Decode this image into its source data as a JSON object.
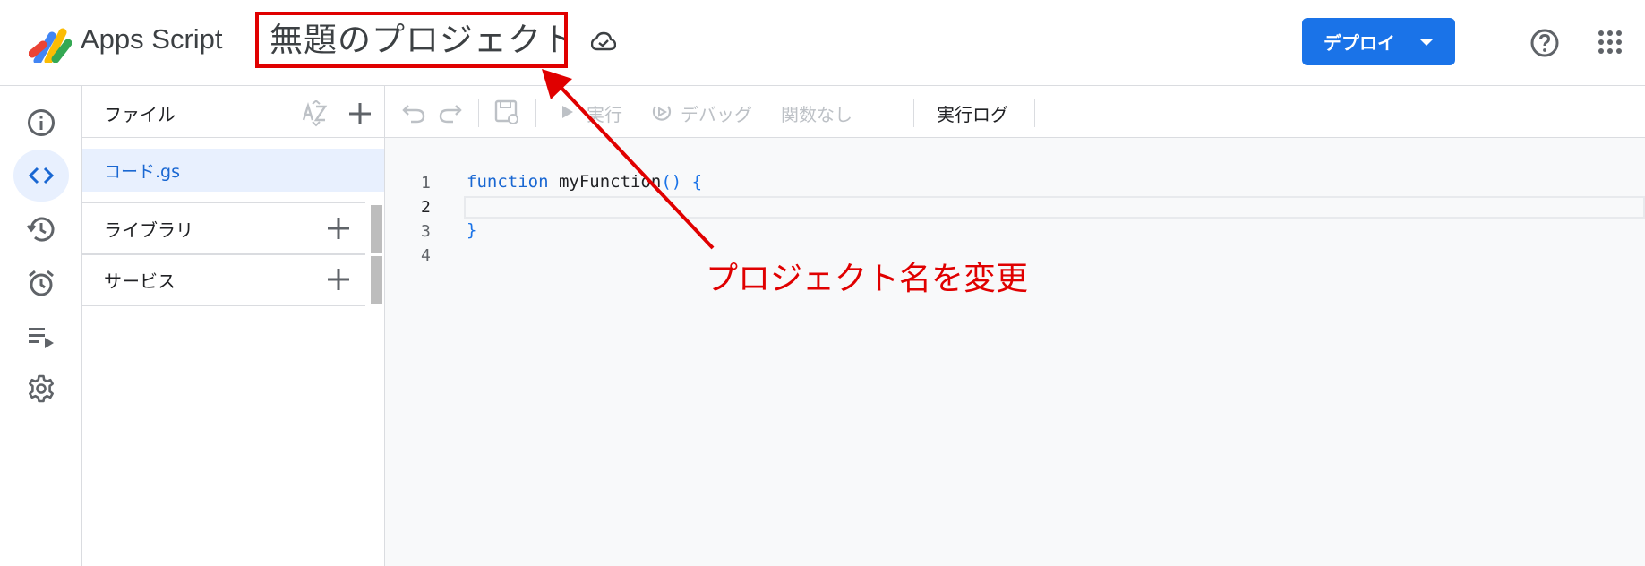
{
  "header": {
    "app_name": "Apps Script",
    "project_title": "無題のプロジェクト",
    "deploy_label": "デプロイ"
  },
  "leftnav": {
    "items": [
      {
        "icon": "info-icon",
        "active": false
      },
      {
        "icon": "code-icon",
        "active": true
      },
      {
        "icon": "history-icon",
        "active": false
      },
      {
        "icon": "alarm-icon",
        "active": false
      },
      {
        "icon": "executions-icon",
        "active": false
      },
      {
        "icon": "gear-icon",
        "active": false
      }
    ]
  },
  "files": {
    "title": "ファイル",
    "items": [
      {
        "name": "コード.gs"
      }
    ],
    "sections": [
      {
        "name": "ライブラリ"
      },
      {
        "name": "サービス"
      }
    ]
  },
  "toolbar": {
    "run_label": "実行",
    "debug_label": "デバッグ",
    "function_label": "関数なし",
    "log_label": "実行ログ"
  },
  "editor": {
    "line_numbers": [
      "1",
      "2",
      "3",
      "4"
    ],
    "lines": {
      "l1_kw": "function",
      "l1_fn": " myFunction",
      "l1_pn": "() {",
      "l3": "}"
    }
  },
  "annotation": {
    "text": "プロジェクト名を変更",
    "color": "#e00000"
  },
  "colors": {
    "accent": "#1a73e8",
    "selected_bg": "#e8f0fe",
    "annotation_red": "#e00000"
  }
}
